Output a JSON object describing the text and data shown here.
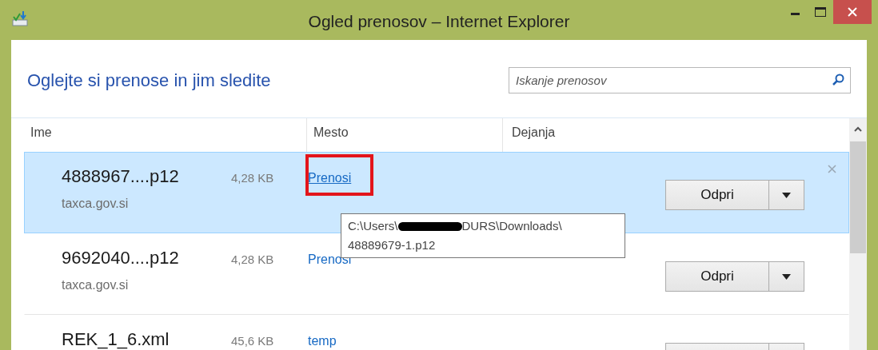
{
  "window": {
    "title": "Ogled prenosov – Internet Explorer"
  },
  "heading": "Oglejte si prenose in jim sledite",
  "search": {
    "placeholder": "Iskanje prenosov"
  },
  "columns": [
    "Ime",
    "Mesto",
    "Dejanja"
  ],
  "downloads": [
    {
      "name": "4888967....p12",
      "size": "4,28 KB",
      "source": "taxca.gov.si",
      "location": "Prenosi",
      "action": "Odpri",
      "selected": true,
      "highlighted": true
    },
    {
      "name": "9692040....p12",
      "size": "4,28 KB",
      "source": "taxca.gov.si",
      "location": "Prenosi",
      "action": "Odpri",
      "selected": false,
      "highlighted": false
    },
    {
      "name": "REK_1_6.xml",
      "size": "45,6 KB",
      "location": "temp",
      "selected": false,
      "highlighted": false
    }
  ],
  "tooltip": {
    "path_start": "C:\\Users\\",
    "path_end": "DURS\\Downloads\\",
    "file": "48889679-1.p12",
    "redacted": true
  }
}
